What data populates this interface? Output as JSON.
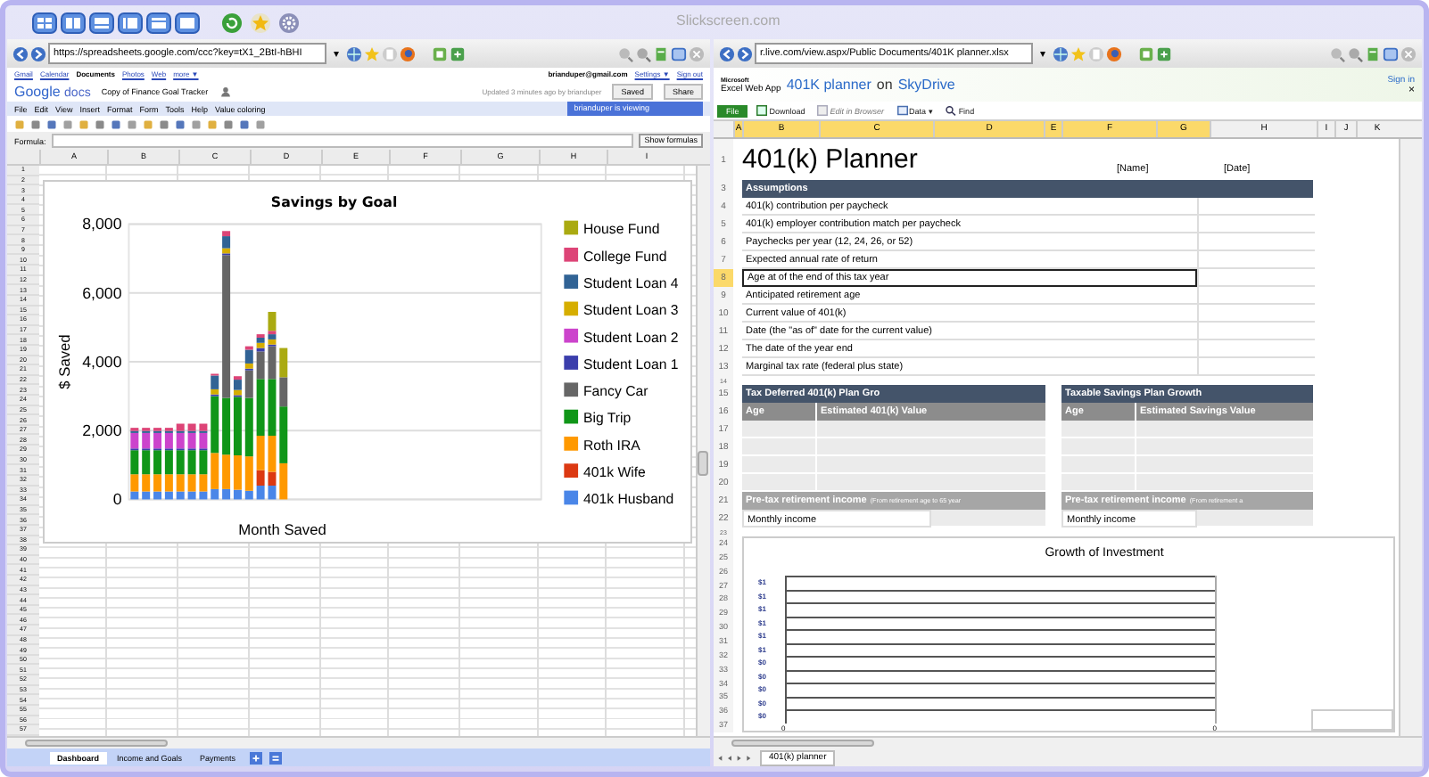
{
  "app": {
    "title": "Slickscreen.com"
  },
  "left_pane": {
    "browser": {
      "url": "https://spreadsheets.google.com/ccc?key=tX1_2BtI-hBHI",
      "url_caret": "▾"
    },
    "google_bar": {
      "links": [
        {
          "label": "Gmail",
          "selected": false
        },
        {
          "label": "Calendar",
          "selected": false
        },
        {
          "label": "Documents",
          "selected": true
        },
        {
          "label": "Photos",
          "selected": false
        },
        {
          "label": "Web",
          "selected": false
        },
        {
          "label": "more ▼",
          "selected": false
        }
      ],
      "account": "brianduper@gmail.com",
      "settings": "Settings ▼",
      "sign_out": "Sign out"
    },
    "docs_header": {
      "logo_google": "Google",
      "logo_docs": "docs",
      "title": "Copy of Finance Goal Tracker",
      "status": "Updated 3 minutes ago by brianduper",
      "saved_button": "Saved",
      "share_button": "Share"
    },
    "menu": [
      "File",
      "Edit",
      "View",
      "Insert",
      "Format",
      "Form",
      "Tools",
      "Help",
      "Value coloring"
    ],
    "viewing": "brianduper is viewing",
    "formula": {
      "label": "Formula:",
      "button": "Show formulas"
    },
    "sheet": {
      "columns": [
        "A",
        "B",
        "C",
        "D",
        "E",
        "F",
        "G",
        "H",
        "I"
      ],
      "rows": [
        "1",
        "2",
        "3",
        "4",
        "5",
        "6",
        "7",
        "8",
        "9",
        "10",
        "11",
        "12",
        "13",
        "14",
        "15",
        "16",
        "17",
        "18",
        "19",
        "20",
        "21",
        "22",
        "23",
        "24",
        "25",
        "26",
        "27",
        "28",
        "29",
        "30",
        "31",
        "32",
        "33",
        "34",
        "35",
        "36",
        "37",
        "38",
        "39",
        "40",
        "41",
        "42",
        "43",
        "44",
        "45",
        "46",
        "47",
        "48",
        "49",
        "50",
        "51",
        "52",
        "53",
        "54",
        "55",
        "56",
        "57"
      ],
      "chart_data": {
        "type": "bar",
        "stacked": true,
        "title": "Savings by Goal",
        "xlabel": "Month Saved",
        "ylabel": "$ Saved",
        "ylim": [
          0,
          8000
        ],
        "grid": true,
        "legend": true,
        "yticks": [
          {
            "value": 0,
            "label": "0"
          },
          {
            "value": 2000,
            "label": "2,000"
          },
          {
            "value": 4000,
            "label": "4,000"
          },
          {
            "value": 6000,
            "label": "6,000"
          },
          {
            "value": 8000,
            "label": "8,000"
          }
        ],
        "series": [
          {
            "name": "401k Husband",
            "color": "#4a86e8",
            "values": [
              230,
              230,
              230,
              230,
              230,
              230,
              230,
              300,
              300,
              280,
              250,
              400,
              400,
              0
            ]
          },
          {
            "name": "401k Wife",
            "color": "#dc3912",
            "values": [
              0,
              0,
              0,
              0,
              0,
              0,
              0,
              0,
              0,
              0,
              0,
              450,
              400,
              0
            ]
          },
          {
            "name": "Roth IRA",
            "color": "#ff9900",
            "values": [
              500,
              500,
              500,
              500,
              500,
              500,
              500,
              1050,
              1000,
              1000,
              1000,
              1000,
              1050,
              1050
            ]
          },
          {
            "name": "Big Trip",
            "color": "#109618",
            "values": [
              700,
              700,
              700,
              700,
              700,
              700,
              700,
              1650,
              1650,
              1700,
              1700,
              1650,
              1650,
              1650
            ]
          },
          {
            "name": "Fancy Car",
            "color": "#666666",
            "values": [
              0,
              0,
              0,
              0,
              0,
              0,
              0,
              0,
              4150,
              0,
              800,
              800,
              950,
              850
            ]
          },
          {
            "name": "Student Loan 1",
            "color": "#3b3eac",
            "values": [
              50,
              50,
              50,
              50,
              50,
              50,
              50,
              50,
              50,
              50,
              50,
              100,
              50,
              0
            ]
          },
          {
            "name": "Student Loan 2",
            "color": "#cc44cc",
            "values": [
              450,
              450,
              450,
              450,
              450,
              450,
              450,
              0,
              0,
              0,
              0,
              0,
              0,
              0
            ]
          },
          {
            "name": "Student Loan 3",
            "color": "#d6ae00",
            "values": [
              0,
              0,
              0,
              0,
              0,
              0,
              0,
              150,
              150,
              150,
              150,
              150,
              150,
              0
            ]
          },
          {
            "name": "Student Loan 4",
            "color": "#316395",
            "values": [
              60,
              60,
              60,
              60,
              60,
              60,
              60,
              400,
              350,
              300,
              400,
              150,
              150,
              0
            ]
          },
          {
            "name": "College Fund",
            "color": "#dd4477",
            "values": [
              90,
              90,
              90,
              90,
              210,
              210,
              210,
              50,
              150,
              100,
              100,
              100,
              100,
              0
            ]
          },
          {
            "name": "House Fund",
            "color": "#aaaa11",
            "values": [
              0,
              0,
              0,
              0,
              0,
              0,
              0,
              0,
              0,
              0,
              0,
              0,
              550,
              850
            ]
          }
        ]
      }
    },
    "tabs": [
      {
        "label": "Dashboard",
        "selected": true
      },
      {
        "label": "Income and Goals",
        "selected": false
      },
      {
        "label": "Payments",
        "selected": false
      }
    ]
  },
  "right_pane": {
    "browser": {
      "url": "r.live.com/view.aspx/Public Documents/401K planner.xlsx",
      "url_caret": "▾"
    },
    "excel_header": {
      "brand_small": "Microsoft",
      "brand": "Excel Web App",
      "doc": "401K planner",
      "on": "on",
      "service": "SkyDrive",
      "sign_in": "Sign in",
      "close": "×"
    },
    "ribbon": [
      {
        "label": "File",
        "kind": "file",
        "disabled": false
      },
      {
        "label": "Download",
        "kind": "download",
        "disabled": false
      },
      {
        "label": "Edit in Browser",
        "kind": "edit",
        "disabled": true
      },
      {
        "label": "Data ▾",
        "kind": "data",
        "disabled": false
      },
      {
        "label": "Find",
        "kind": "find",
        "disabled": false
      }
    ],
    "columns": [
      {
        "label": "A",
        "selected": true
      },
      {
        "label": "B",
        "selected": true
      },
      {
        "label": "C",
        "selected": true
      },
      {
        "label": "D",
        "selected": true
      },
      {
        "label": "E",
        "selected": true
      },
      {
        "label": "F",
        "selected": true
      },
      {
        "label": "G",
        "selected": true
      },
      {
        "label": "H",
        "selected": false
      },
      {
        "label": "I",
        "selected": false
      },
      {
        "label": "J",
        "selected": false
      },
      {
        "label": "K",
        "selected": false
      }
    ],
    "title_row": {
      "row_heading": "1",
      "title": "401(k) Planner",
      "name": "[Name]",
      "date": "[Date]"
    },
    "assumptions": {
      "row_heading": "3",
      "label": "Assumptions",
      "items": [
        {
          "row_heading": "4",
          "label": "401(k) contribution per paycheck",
          "selected": false
        },
        {
          "row_heading": "5",
          "label": "401(k) employer contribution match per paycheck",
          "selected": false
        },
        {
          "row_heading": "6",
          "label": "Paychecks per year (12, 24, 26, or 52)",
          "selected": false
        },
        {
          "row_heading": "7",
          "label": "Expected annual rate of return",
          "selected": false
        },
        {
          "row_heading": "8",
          "label": "Age at of the end of this tax year",
          "selected": true
        },
        {
          "row_heading": "9",
          "label": "Anticipated retirement age",
          "selected": false
        },
        {
          "row_heading": "10",
          "label": "Current value of 401(k)",
          "selected": false
        },
        {
          "row_heading": "11",
          "label": "Date (the \"as of\" date for the current value)",
          "selected": false
        },
        {
          "row_heading": "12",
          "label": "The date of the year end",
          "selected": false
        },
        {
          "row_heading": "13",
          "label": "Marginal tax rate (federal plus state)",
          "selected": false
        }
      ]
    },
    "spacer_row": "14",
    "table_rows": {
      "header": "15",
      "columns": "16",
      "blank": [
        "17",
        "18",
        "19",
        "20"
      ],
      "income": "21",
      "monthly": "22"
    },
    "tables": [
      {
        "title": "Tax Deferred 401(k) Plan Gro",
        "columns": [
          "Age",
          "Estimated 401(k) Value"
        ],
        "income_label": "Pre-tax retirement income",
        "income_note": "(From retirement age to 65 year",
        "monthly_label": "Monthly income"
      },
      {
        "title": "Taxable Savings Plan Growth",
        "columns": [
          "Age",
          "Estimated Savings Value"
        ],
        "income_label": "Pre-tax retirement income",
        "income_note": "(From retirement a",
        "monthly_label": "Monthly income"
      }
    ],
    "gap_row": "23",
    "chart": {
      "rows": [
        "24",
        "25",
        "26",
        "27",
        "28",
        "29",
        "30",
        "31",
        "32",
        "33",
        "34",
        "35",
        "36",
        "37"
      ],
      "title": "Growth of Investment",
      "y_labels": [
        "$1",
        "$1",
        "$1",
        "$1",
        "$1",
        "$1",
        "$0",
        "$0",
        "$0",
        "$0",
        "$0"
      ],
      "x_labels": [
        "0",
        "0"
      ]
    },
    "tabs": [
      {
        "label": "401(k) planner",
        "selected": true
      }
    ]
  }
}
